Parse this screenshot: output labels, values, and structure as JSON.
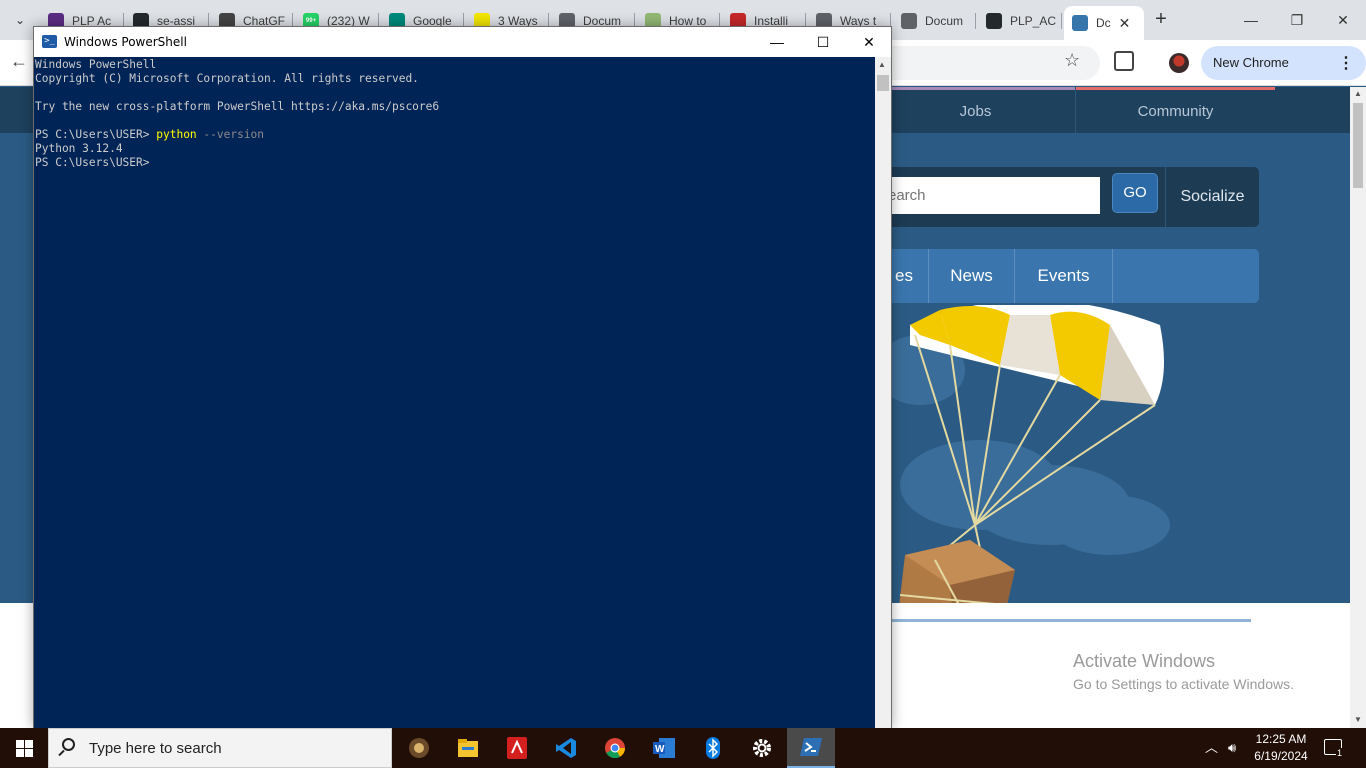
{
  "browser": {
    "tabs": [
      {
        "title": "PLP Ac",
        "icon": "plp-icon",
        "color": "#5b2c83"
      },
      {
        "title": "se-assi",
        "icon": "github-icon",
        "color": "#24292e"
      },
      {
        "title": "ChatGF",
        "icon": "openai-icon",
        "color": "#444444"
      },
      {
        "title": "(232) W",
        "icon": "whatsapp-icon",
        "color": "#25d366",
        "badge": "99+"
      },
      {
        "title": "Google",
        "icon": "google-meet-icon",
        "color": "#00897b"
      },
      {
        "title": "3 Ways",
        "icon": "w-icon",
        "color": "#f2e600"
      },
      {
        "title": "Docum",
        "icon": "globe-icon",
        "color": "#5f6368"
      },
      {
        "title": "How to",
        "icon": "wikihow-icon",
        "color": "#93b874"
      },
      {
        "title": "Installi",
        "icon": "tr-icon",
        "color": "#c62828"
      },
      {
        "title": "Ways t",
        "icon": "globe-icon",
        "color": "#5f6368"
      },
      {
        "title": "Docum",
        "icon": "globe-icon",
        "color": "#5f6368"
      },
      {
        "title": "PLP_AC",
        "icon": "github-icon",
        "color": "#24292e"
      },
      {
        "title": "Dc",
        "icon": "python-icon",
        "color": "#3776ab",
        "active": true
      }
    ],
    "update_label": "New Chrome available"
  },
  "python_site": {
    "top_nav": [
      "Jobs",
      "Community"
    ],
    "search_placeholder": "earch",
    "go_label": "GO",
    "socialize_label": "Socialize",
    "sub_nav": [
      "es",
      "News",
      "Events"
    ]
  },
  "watermark": {
    "line1": "Activate Windows",
    "line2": "Go to Settings to activate Windows."
  },
  "powershell": {
    "title": "Windows PowerShell",
    "lines": [
      {
        "text": "Windows PowerShell"
      },
      {
        "text": "Copyright (C) Microsoft Corporation. All rights reserved."
      },
      {
        "text": ""
      },
      {
        "text": "Try the new cross-platform PowerShell https://aka.ms/pscore6"
      },
      {
        "text": ""
      },
      {
        "prompt": "PS C:\\Users\\USER> ",
        "cmd": "python",
        "arg": " --version"
      },
      {
        "text": "Python 3.12.4"
      },
      {
        "text": "PS C:\\Users\\USER>"
      }
    ]
  },
  "taskbar": {
    "search_placeholder": "Type here to search",
    "apps": [
      "media-player-icon",
      "file-explorer-icon",
      "acrobat-icon",
      "vscode-icon",
      "chrome-icon",
      "word-icon",
      "bluetooth-icon",
      "settings-icon",
      "powershell-icon"
    ],
    "time": "12:25 AM",
    "date": "6/19/2024",
    "notification_count": "1"
  }
}
